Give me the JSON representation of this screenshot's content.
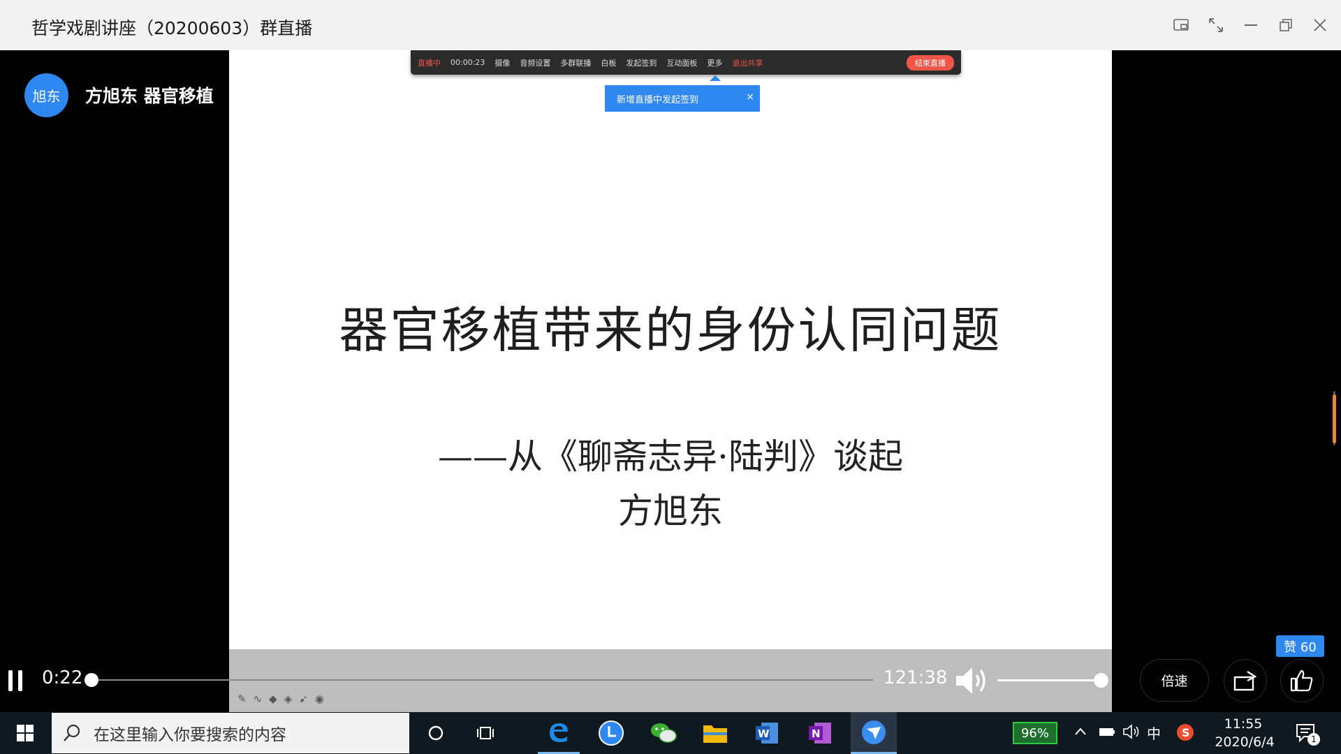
{
  "window": {
    "title": "哲学戏剧讲座（20200603）群直播"
  },
  "channel": {
    "avatar_text": "旭东",
    "name": "方旭东 器官移植"
  },
  "recording_toolbar": {
    "items": [
      "直播中",
      "00:00:23",
      "摄像",
      "音频设置",
      "多群联播",
      "白板",
      "发起签到",
      "互动面板",
      "更多",
      "退出共享"
    ],
    "end_label": "结束直播"
  },
  "notice": {
    "text": "新增直播中发起签到",
    "close": "×"
  },
  "slide": {
    "title": "器官移植带来的身份认同问题",
    "subtitle": "——从《聊斋志异·陆判》谈起",
    "author": "方旭东"
  },
  "player": {
    "current_time": "0:22",
    "total_time": "121:38",
    "progress_fraction": 0.003,
    "volume_fraction": 1.0,
    "speed_label": "倍速",
    "like_label": "赞 60"
  },
  "taskbar": {
    "search_placeholder": "在这里输入你要搜索的内容",
    "battery": "96%",
    "ime": "中",
    "time": "11:55",
    "date": "2020/6/4",
    "notification_count": "1"
  },
  "colors": {
    "accent": "#2f88f0",
    "record_red": "#f0554a",
    "battery_green": "#2ecc40"
  },
  "icons": [
    "pip-icon",
    "fullscreen-icon",
    "minimize-icon",
    "restore-icon",
    "close-icon",
    "pause-icon",
    "volume-icon",
    "share-icon",
    "thumbs-up-icon",
    "windows-logo-icon",
    "search-icon",
    "cortana-icon",
    "task-view-icon",
    "edge-icon",
    "clock-app-icon",
    "wechat-icon",
    "file-explorer-icon",
    "word-icon",
    "onenote-icon",
    "feishu-icon",
    "chevron-up-icon",
    "battery-tray-icon",
    "speaker-icon",
    "sogou-icon",
    "notification-icon"
  ]
}
